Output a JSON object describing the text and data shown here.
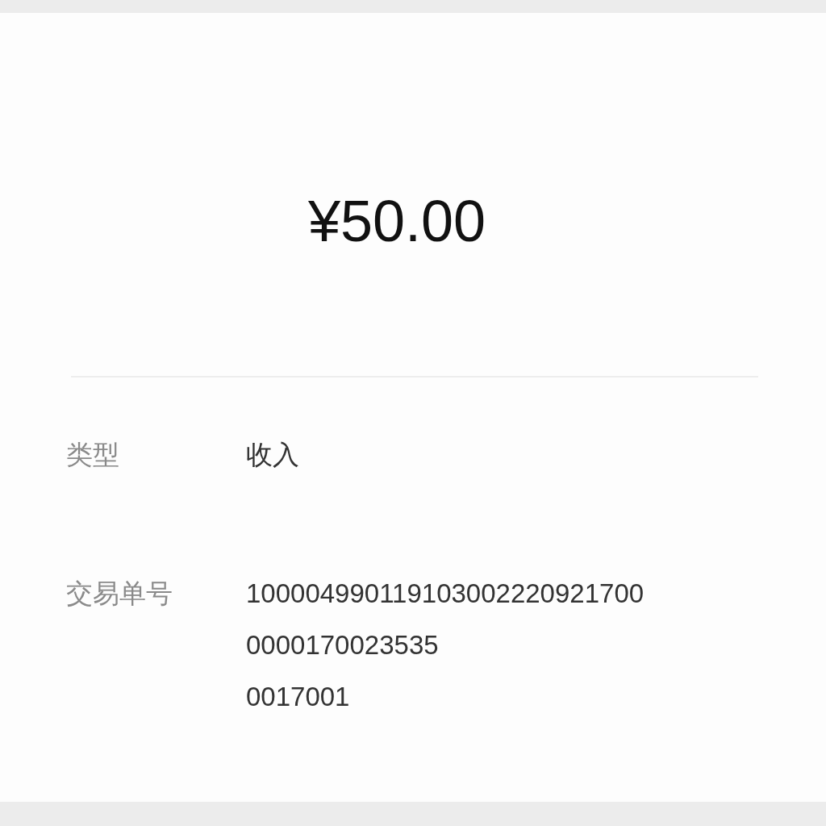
{
  "amount": "¥50.00",
  "details": [
    {
      "label": "类型",
      "value_lines": [
        "收入"
      ]
    },
    {
      "label": "交易单号",
      "value_lines": [
        "100004990119103002220921700",
        "0000170023535",
        "0017001"
      ]
    }
  ]
}
